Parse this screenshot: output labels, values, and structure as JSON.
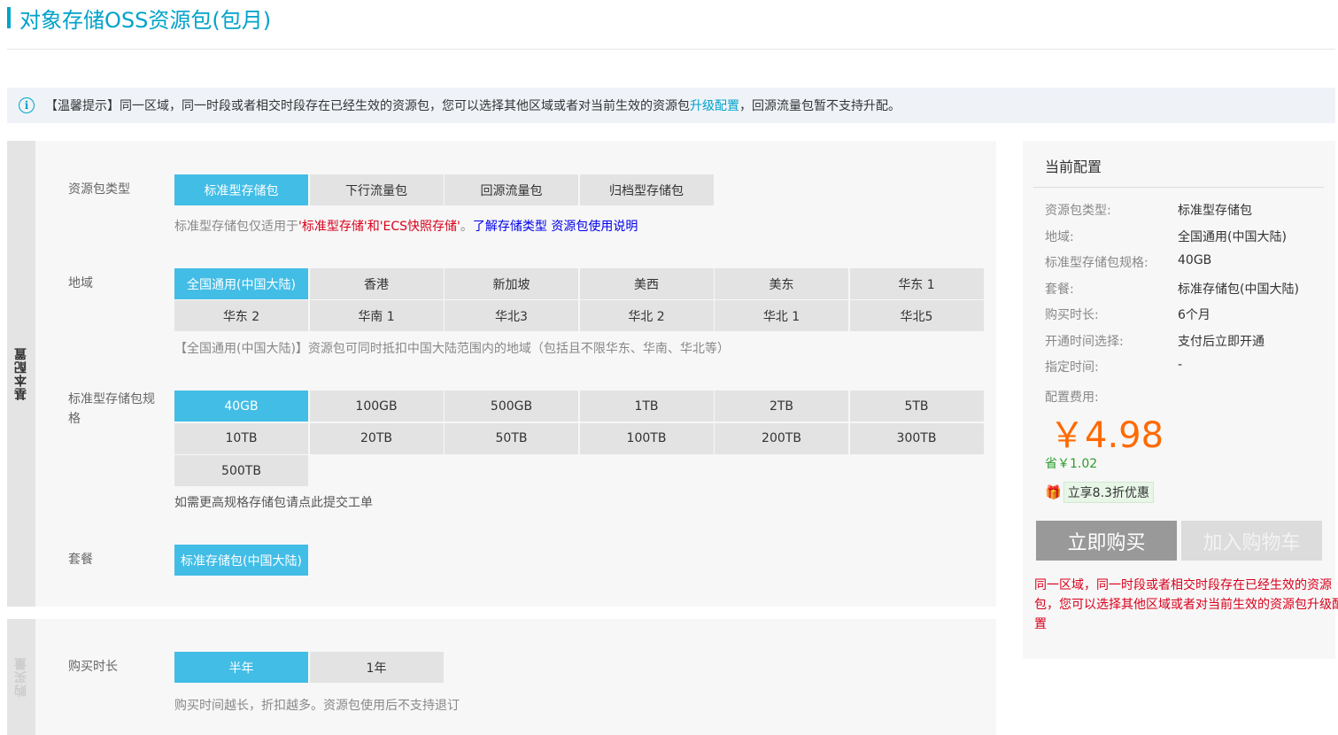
{
  "page": {
    "title": "对象存储OSS资源包(包月)"
  },
  "notice": {
    "text_before": "【温馨提示】同一区域，同一时段或者相交时段存在已经生效的资源包，您可以选择其他区域或者对当前生效的资源包",
    "link": "升级配置",
    "text_after": "，回源流量包暂不支持升配。"
  },
  "basic": {
    "side_label": "基本配置",
    "package_type": {
      "label": "资源包类型",
      "options": [
        "标准型存储包",
        "下行流量包",
        "回源流量包",
        "归档型存储包"
      ],
      "selected": 0,
      "hint_prefix": "标准型存储包仅适用于",
      "hint_red": "'标准型存储'和'ECS快照存储'",
      "hint_sep": "。",
      "hint_link1": "了解存储类型",
      "hint_link2": "资源包使用说明"
    },
    "region": {
      "label": "地域",
      "options": [
        "全国通用(中国大陆)",
        "香港",
        "新加坡",
        "美西",
        "美东",
        "华东 1",
        "华东 2",
        "华南 1",
        "华北3",
        "华北 2",
        "华北 1",
        "华北5"
      ],
      "selected": 0,
      "hint": "【全国通用(中国大陆)】资源包可同时抵扣中国大陆范围内的地域（包括且不限华东、华南、华北等）"
    },
    "spec": {
      "label": "标准型存储包规格",
      "options": [
        "40GB",
        "100GB",
        "500GB",
        "1TB",
        "2TB",
        "5TB",
        "10TB",
        "20TB",
        "50TB",
        "100TB",
        "200TB",
        "300TB",
        "500TB"
      ],
      "selected": 0,
      "hint_prefix": "如需更高规格存储包请点此",
      "hint_link": "提交工单"
    },
    "plan": {
      "label": "套餐",
      "options": [
        "标准存储包(中国大陆)"
      ],
      "selected": 0
    }
  },
  "duration": {
    "side_label": "购买量",
    "label": "购买时长",
    "options": [
      "半年",
      "1年"
    ],
    "selected": 0,
    "hint": "购买时间越长，折扣越多。资源包使用后不支持退订"
  },
  "summary": {
    "title": "当前配置",
    "rows": [
      {
        "k": "资源包类型:",
        "v": "标准型存储包"
      },
      {
        "k": "地域:",
        "v": "全国通用(中国大陆)"
      },
      {
        "k": "标准型存储包规格:",
        "v": "40GB"
      },
      {
        "k": "套餐:",
        "v": "标准存储包(中国大陆)"
      },
      {
        "k": "购买时长:",
        "v": "6个月"
      },
      {
        "k": "开通时间选择:",
        "v": "支付后立即开通"
      },
      {
        "k": "指定时间:",
        "v": "-"
      }
    ],
    "fee_label": "配置费用:",
    "price": "￥4.98",
    "save": "省￥1.02",
    "promo": "立享8.3折优惠",
    "buy": "立即购买",
    "cart": "加入购物车",
    "warning": "同一区域，同一时段或者相交时段存在已经生效的资源包，您可以选择其他区域或者对当前生效的资源包升级配置"
  },
  "colors": {
    "accent": "#00a2ca",
    "selected": "#42bde6",
    "price": "#ff6a00",
    "warn": "#d9001b",
    "save": "#2b9c2b"
  }
}
